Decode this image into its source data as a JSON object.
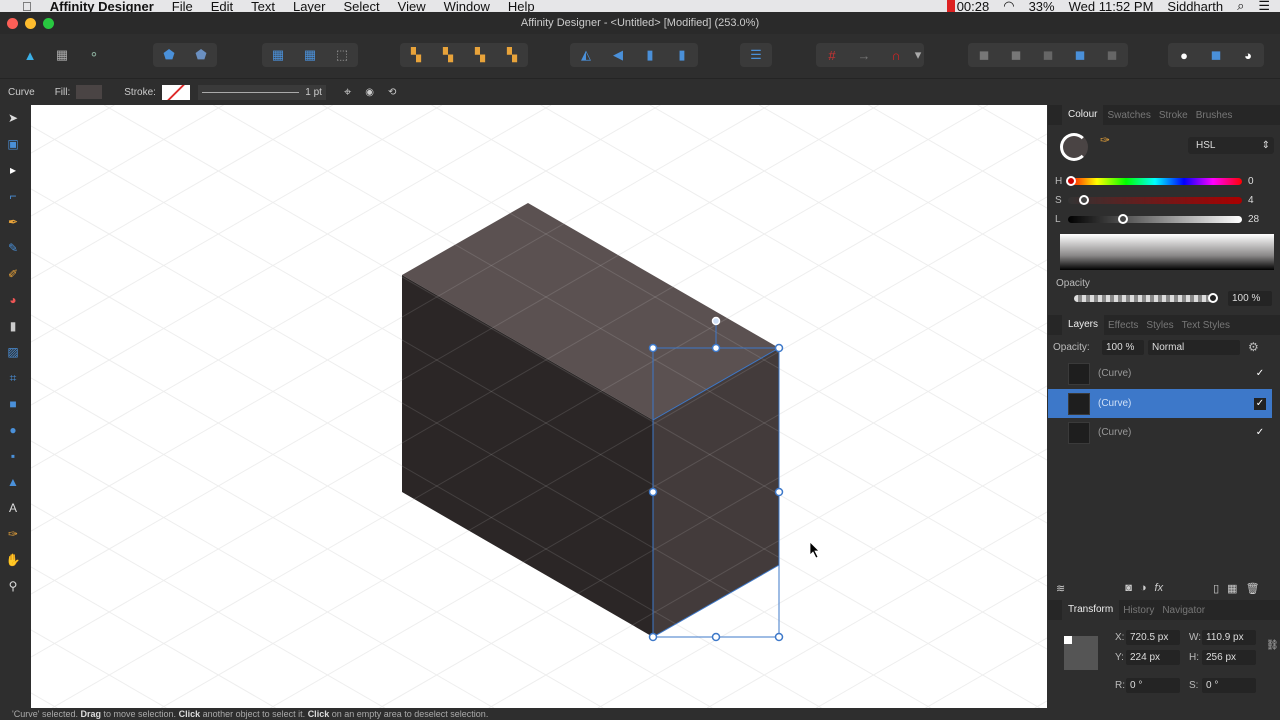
{
  "menubar": {
    "app": "Affinity Designer",
    "items": [
      "File",
      "Edit",
      "Text",
      "Layer",
      "Select",
      "View",
      "Window",
      "Help"
    ],
    "timer": "00:28",
    "battery": "33%",
    "clock": "Wed 11:52 PM",
    "user": "Siddharth"
  },
  "window": {
    "title": "Affinity Designer - <Untitled> [Modified] (253.0%)"
  },
  "context": {
    "tool": "Curve",
    "fill_label": "Fill:",
    "stroke_label": "Stroke:",
    "stroke_width": "1 pt",
    "fill_color": "#4a4444"
  },
  "colour_panel": {
    "tabs": [
      "Colour",
      "Swatches",
      "Stroke",
      "Brushes"
    ],
    "model": "HSL",
    "h_label": "H",
    "h": "0",
    "s_label": "S",
    "s": "4",
    "l_label": "L",
    "l": "28",
    "h_fraction": 0,
    "s_fraction": 0.04,
    "l_fraction": 0.28,
    "opacity_label": "Opacity",
    "opacity": "100 %"
  },
  "layers_panel": {
    "tabs": [
      "Layers",
      "Effects",
      "Styles",
      "Text Styles"
    ],
    "opacity_label": "Opacity:",
    "opacity": "100 %",
    "blend": "Normal",
    "layers": [
      {
        "name": "(Curve)"
      },
      {
        "name": "(Curve)",
        "selected": true
      },
      {
        "name": "(Curve)"
      }
    ]
  },
  "transform_panel": {
    "tabs": [
      "Transform",
      "History",
      "Navigator"
    ],
    "x_label": "X:",
    "x": "720.5 px",
    "y_label": "Y:",
    "y": "224 px",
    "w_label": "W:",
    "w": "110.9 px",
    "h_label": "H:",
    "h": "256 px",
    "r_label": "R:",
    "r": "0 °",
    "s_label": "S:",
    "s": "0 °"
  },
  "status": {
    "pre": "'Curve' selected.",
    "b1": "Drag",
    "t1": "to move selection.",
    "b2": "Click",
    "t2": "another object to select it.",
    "b3": "Click",
    "t3": "on an empty area to deselect selection."
  },
  "colors": {
    "accent": "#3d78c9",
    "top_face": "#5b5151",
    "left_face": "#2b2626",
    "right_face": "#433b3b"
  }
}
